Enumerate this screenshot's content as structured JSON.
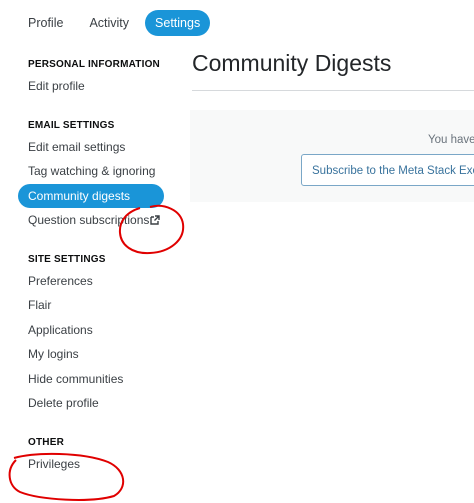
{
  "tabs": [
    {
      "label": "Profile"
    },
    {
      "label": "Activity"
    },
    {
      "label": "Settings",
      "active": true
    }
  ],
  "sidebar": {
    "sections": [
      {
        "title": "PERSONAL INFORMATION",
        "items": [
          {
            "label": "Edit profile"
          }
        ]
      },
      {
        "title": "EMAIL SETTINGS",
        "items": [
          {
            "label": "Edit email settings"
          },
          {
            "label": "Tag watching & ignoring"
          },
          {
            "label": "Community digests",
            "active": true
          },
          {
            "label": "Question subscriptions",
            "icon": "external-link-icon"
          }
        ]
      },
      {
        "title": "SITE SETTINGS",
        "items": [
          {
            "label": "Preferences"
          },
          {
            "label": "Flair"
          },
          {
            "label": "Applications"
          },
          {
            "label": "My logins"
          },
          {
            "label": "Hide communities"
          },
          {
            "label": "Delete profile"
          }
        ]
      },
      {
        "title": "OTHER",
        "items": [
          {
            "label": "Privileges"
          }
        ]
      }
    ]
  },
  "main": {
    "title": "Community Digests",
    "notice_text": "You have",
    "subscribe_label": "Subscribe to the Meta Stack Exch"
  },
  "colors": {
    "accent": "#1a95d8",
    "annotation": "#e00000"
  }
}
